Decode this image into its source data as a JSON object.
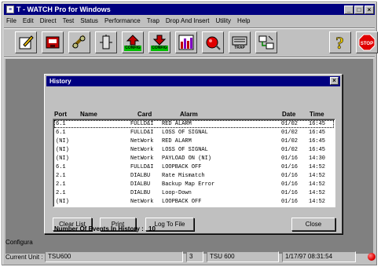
{
  "window": {
    "title": "T - WATCH Pro for Windows",
    "controls": [
      "_",
      "□",
      "×"
    ]
  },
  "menu": [
    "File",
    "Edit",
    "Direct",
    "Test",
    "Status",
    "Performance",
    "Trap",
    "Drop And Insert",
    "Utility",
    "Help"
  ],
  "toolbar": {
    "config_up_label": "CONFIG",
    "config_down_label": "CONFIG",
    "trap_label": "TRAP",
    "tools": [
      "edit-tool",
      "connect-tool",
      "cable-tool",
      "device-tool",
      "config-upload",
      "config-download",
      "performance-chart",
      "alarm-tool",
      "trap-tool",
      "network-tool",
      "help-tool",
      "stop-tool"
    ],
    "stop_label": "STOP"
  },
  "history": {
    "title": "History",
    "columns": {
      "port": "Port",
      "name": "Name",
      "card": "Card",
      "alarm": "Alarm",
      "date": "Date",
      "time": "Time"
    },
    "rows": [
      {
        "port": "6.1",
        "name": "",
        "card": "FULLD&I",
        "alarm": "RED ALARM",
        "date": "01/02",
        "time": "16:45"
      },
      {
        "port": "6.1",
        "name": "",
        "card": "FULLD&I",
        "alarm": "LOSS OF SIGNAL",
        "date": "01/02",
        "time": "16:45"
      },
      {
        "port": "(NI)",
        "name": "",
        "card": "NetWork",
        "alarm": "RED ALARM",
        "date": "01/02",
        "time": "16:45"
      },
      {
        "port": "(NI)",
        "name": "",
        "card": "NetWork",
        "alarm": "LOSS OF SIGNAL",
        "date": "01/02",
        "time": "16:45"
      },
      {
        "port": "(NI)",
        "name": "",
        "card": "NetWork",
        "alarm": "PAYLOAD ON (NI)",
        "date": "01/16",
        "time": "14:30"
      },
      {
        "port": "6.1",
        "name": "",
        "card": "FULLD&I",
        "alarm": "LOOPBACK OFF",
        "date": "01/16",
        "time": "14:52"
      },
      {
        "port": "2.1",
        "name": "",
        "card": "DIALBU",
        "alarm": "Rate Mismatch",
        "date": "01/16",
        "time": "14:52"
      },
      {
        "port": "2.1",
        "name": "",
        "card": "DIALBU",
        "alarm": "Backup Map Error",
        "date": "01/16",
        "time": "14:52"
      },
      {
        "port": "2.1",
        "name": "",
        "card": "DIALBU",
        "alarm": "Loop-Down",
        "date": "01/16",
        "time": "14:52"
      },
      {
        "port": "(NI)",
        "name": "",
        "card": "NetWork",
        "alarm": "LOOPBACK OFF",
        "date": "01/16",
        "time": "14:52"
      }
    ],
    "buttons": {
      "clear": "Clear List",
      "print": "Print",
      "log": "Log To File",
      "close": "Close"
    },
    "events_label": "Number Of Events In History :",
    "events_count": "10"
  },
  "status": {
    "config_label": "Configura",
    "current_unit_label": "Current Unit :",
    "unit": "TSU600",
    "slot": "3",
    "unit_model": "TSU 600",
    "datetime": "1/17/97  08:31:54",
    "led_color": "#e00000"
  }
}
